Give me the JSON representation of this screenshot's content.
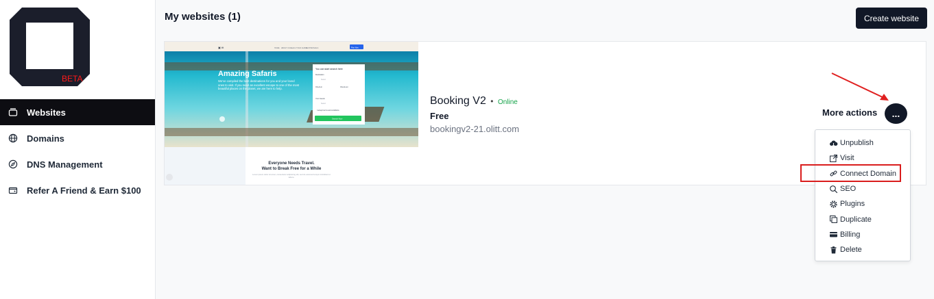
{
  "logo": {
    "badge": "BETA",
    "badge_color": "#ff1a1a"
  },
  "sidebar": {
    "items": [
      {
        "label": "Websites",
        "icon": "websites-icon",
        "active": true
      },
      {
        "label": "Domains",
        "icon": "globe-icon"
      },
      {
        "label": "DNS Management",
        "icon": "compass-icon"
      },
      {
        "label": "Refer A Friend & Earn $100",
        "icon": "wallet-icon"
      }
    ]
  },
  "header": {
    "title": "My websites (1)",
    "create_label": "Create website"
  },
  "site": {
    "name": "Booking V2",
    "dot": "•",
    "status": "Online",
    "plan": "Free",
    "url": "bookingv2-21.olitt.com",
    "thumbnail": {
      "nav_logo": "▣ tft",
      "nav_links": [
        "HOME",
        "ABOUT US",
        "DEALS",
        "TOUR GUIDE",
        "TESTIMONIALS"
      ],
      "nav_button": "Plan Now",
      "hero_title": "Amazing Safaris",
      "hero_text": "We've compiled the best destinations for you and your loved ones to visit. If you need an excellent escape to one of the most beautiful places on the planet, we are here to help.",
      "form_title": "You can start search here",
      "form_dest": "Destination",
      "form_dest_ph": "Select",
      "form_checkin": "Check-in",
      "form_checkout": "Check-out",
      "form_guests": "Your Guests",
      "form_guests_ph": "Select",
      "form_terms": "I accept terms and conditions",
      "form_button": "Search Now",
      "tagline_1": "Everyone Needs Travel.",
      "tagline_2": "Want to Break Free for a While",
      "tagline_small": "Lorem ipsum dolor sit amet, consectetur adipiscing elit, sed do eiusmod tempor incididunt ut labore."
    }
  },
  "actions": {
    "more_label": "More actions",
    "more_button": "...",
    "menu": [
      {
        "label": "Unpublish",
        "icon": "cloud-icon"
      },
      {
        "label": "Visit",
        "icon": "external-link-icon"
      },
      {
        "label": "Connect Domain",
        "icon": "link-icon"
      },
      {
        "label": "SEO",
        "icon": "search-icon"
      },
      {
        "label": "Plugins",
        "icon": "gear-icon"
      },
      {
        "label": "Duplicate",
        "icon": "copy-icon"
      },
      {
        "label": "Billing",
        "icon": "card-icon"
      },
      {
        "label": "Delete",
        "icon": "trash-icon"
      }
    ]
  },
  "colors": {
    "primary_dark": "#111827",
    "accent_red": "#e02020",
    "online_green": "#16a34a",
    "sea": "#1fb6c9"
  }
}
